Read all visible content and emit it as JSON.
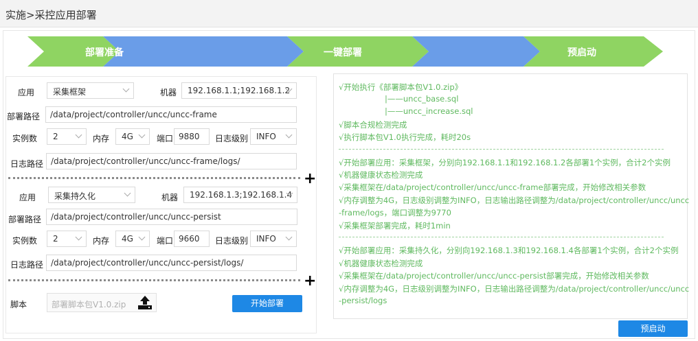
{
  "header": {
    "title": "实施>采控应用部署"
  },
  "steps": [
    {
      "label": "部署准备"
    },
    {
      "label": "一键部署"
    },
    {
      "label": "预启动"
    }
  ],
  "colors": {
    "step_green": "#8fd462",
    "step_blue": "#6a9de8",
    "log_green": "#5fb95f",
    "button_blue": "#1e88e5"
  },
  "group1": {
    "app_label": "应用",
    "app_value": "采集框架",
    "machine_label": "机器",
    "machine_value": "192.168.1.1;192.168.1.2",
    "path_label": "部署路径",
    "path_value": "/data/project/controller/uncc/uncc-frame",
    "instances_label": "实例数",
    "instances_value": "2",
    "memory_label": "内存",
    "memory_value": "4G",
    "port_label": "端口",
    "port_value": "9880",
    "loglevel_label": "日志级别",
    "loglevel_value": "INFO",
    "logpath_label": "日志路径",
    "logpath_value": "/data/project/controller/uncc/uncc-frame/logs/"
  },
  "group2": {
    "app_label": "应用",
    "app_value": "采集持久化",
    "machine_label": "机器",
    "machine_value": "192.168.1.3;192.168.1.4",
    "path_label": "部署路径",
    "path_value": "/data/project/controller/uncc/uncc-persist",
    "instances_label": "实例数",
    "instances_value": "2",
    "memory_label": "内存",
    "memory_value": "4G",
    "port_label": "端口",
    "port_value": "9660",
    "loglevel_label": "日志级别",
    "loglevel_value": "INFO",
    "logpath_label": "日志路径",
    "logpath_value": "/data/project/controller/uncc/uncc-persist/logs/"
  },
  "plus": "+",
  "script": {
    "label": "脚本",
    "placeholder": "部署脚本包V1.0.zip",
    "icon": "upload-icon"
  },
  "buttons": {
    "start_deploy": "开始部署",
    "pre_start": "预启动"
  },
  "log": {
    "lines1": [
      "√开始执行《部署脚本包V1.0.zip》",
      "|——uncc_base.sql",
      "|——uncc_increase.sql",
      "√脚本合规检测完成",
      "√执行脚本包V1.0执行完成，耗时20s"
    ],
    "lines2": [
      "√开始部署应用：采集框架，分别向192.168.1.1和192.168.1.2各部署1个实例，合计2个实例",
      "√机器健康状态检测完成",
      "√采集框架在/data/project/controller/uncc/uncc-frame部署完成，开始修改相关参数",
      "√内存调整为4G，日志级别调整为INFO，日志输出路径调整为/data/project/controller/uncc/uncc",
      "-frame/logs，端口调整为9770",
      "√采集框架部署完成，耗时1min"
    ],
    "lines3": [
      "√开始部署应用：采集持久化，分别向192.168.1.3和192.168.1.4各部署1个实例，合计2个实例",
      "√机器健康状态检测完成",
      "√采集框架在/data/project/controller/uncc/uncc-persist部署完成，开始修改相关参数",
      "√内存调整为4G，日志级别调整为INFO，日志输出路径调整为/data/project/controller/uncc/uncc",
      "-persist/logs"
    ]
  }
}
